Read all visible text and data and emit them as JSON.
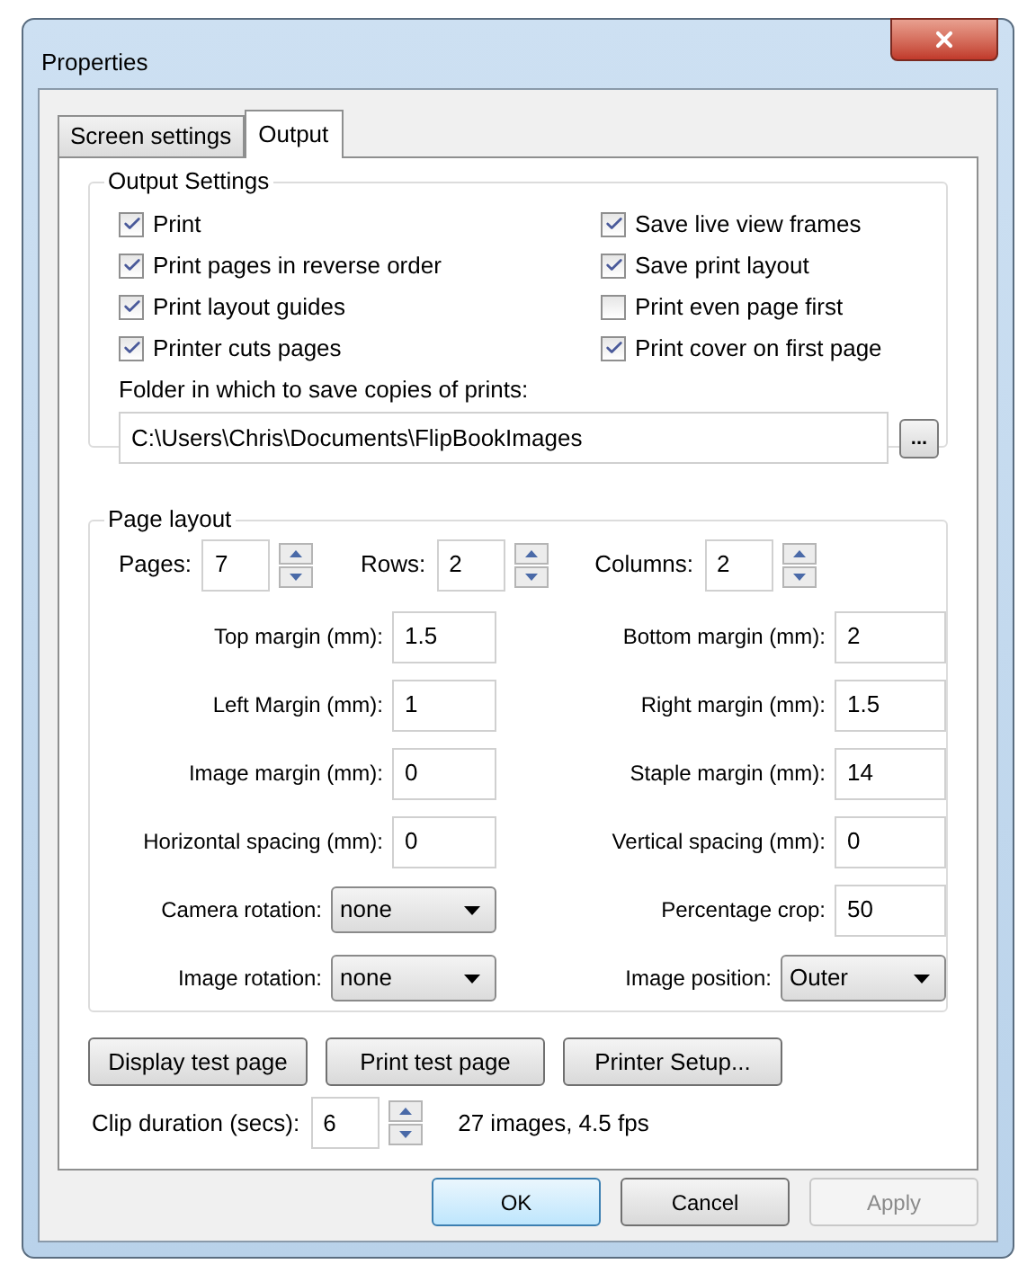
{
  "window": {
    "title": "Properties"
  },
  "tabs": [
    {
      "label": "Screen settings",
      "selected": false
    },
    {
      "label": "Output",
      "selected": true
    }
  ],
  "output_settings": {
    "title": "Output Settings",
    "left_options": [
      {
        "label": "Print",
        "checked": true
      },
      {
        "label": "Print pages in reverse order",
        "checked": true
      },
      {
        "label": "Print layout guides",
        "checked": true
      },
      {
        "label": "Printer cuts pages",
        "checked": true
      }
    ],
    "right_options": [
      {
        "label": "Save live view frames",
        "checked": true
      },
      {
        "label": "Save print layout",
        "checked": true
      },
      {
        "label": "Print even page first",
        "checked": false
      },
      {
        "label": "Print cover on first page",
        "checked": true
      }
    ],
    "folder_label": "Folder in which to save copies of prints:",
    "folder_value": "C:\\Users\\Chris\\Documents\\FlipBookImages",
    "browse_button": "..."
  },
  "page_layout": {
    "title": "Page layout",
    "spinners": [
      {
        "label": "Pages:",
        "value": "7"
      },
      {
        "label": "Rows:",
        "value": "2"
      },
      {
        "label": "Columns:",
        "value": "2"
      }
    ],
    "rows": [
      [
        {
          "kind": "text",
          "label": "Top margin (mm):",
          "value": "1.5"
        },
        {
          "kind": "text",
          "label": "Bottom margin (mm):",
          "value": "2"
        }
      ],
      [
        {
          "kind": "text",
          "label": "Left Margin (mm):",
          "value": "1"
        },
        {
          "kind": "text",
          "label": "Right margin (mm):",
          "value": "1.5"
        }
      ],
      [
        {
          "kind": "text",
          "label": "Image margin (mm):",
          "value": "0"
        },
        {
          "kind": "text",
          "label": "Staple margin (mm):",
          "value": "14"
        }
      ],
      [
        {
          "kind": "text",
          "label": "Horizontal spacing (mm):",
          "value": "0"
        },
        {
          "kind": "text",
          "label": "Vertical spacing (mm):",
          "value": "0"
        }
      ],
      [
        {
          "kind": "dropdown",
          "label": "Camera rotation:",
          "value": "none"
        },
        {
          "kind": "text",
          "label": "Percentage crop:",
          "value": "50"
        }
      ],
      [
        {
          "kind": "dropdown",
          "label": "Image rotation:",
          "value": "none"
        },
        {
          "kind": "dropdown",
          "label": "Image position:",
          "value": "Outer"
        }
      ]
    ]
  },
  "action_buttons": [
    "Display test page",
    "Print test page",
    "Printer Setup..."
  ],
  "clip": {
    "label": "Clip duration (secs):",
    "value": "6",
    "info": "27 images, 4.5 fps"
  },
  "dialog_buttons": [
    {
      "label": "OK",
      "default": true,
      "disabled": false
    },
    {
      "label": "Cancel",
      "default": false,
      "disabled": false
    },
    {
      "label": "Apply",
      "default": false,
      "disabled": true
    }
  ]
}
